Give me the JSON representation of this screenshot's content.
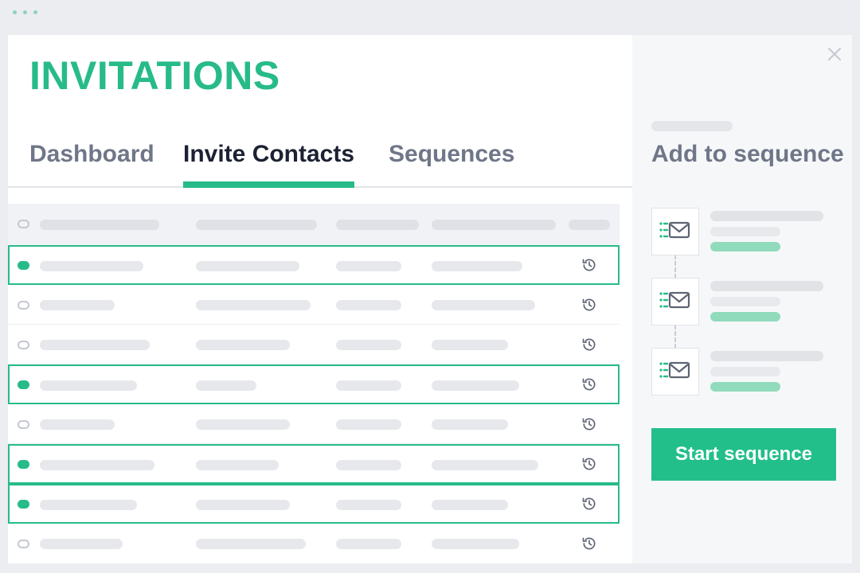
{
  "window_dots": 3,
  "app": {
    "title": "INVITATIONS"
  },
  "tabs": [
    {
      "id": "dashboard",
      "label": "Dashboard",
      "active": false
    },
    {
      "id": "invite",
      "label": "Invite Contacts",
      "active": true
    },
    {
      "id": "sequences",
      "label": "Sequences",
      "active": false
    }
  ],
  "table": {
    "header": {
      "columns": 5,
      "content": "placeholder-skeleton"
    },
    "rows": [
      {
        "selected": true,
        "action_icon": "history-icon"
      },
      {
        "selected": false,
        "action_icon": "history-icon"
      },
      {
        "selected": false,
        "action_icon": "history-icon"
      },
      {
        "selected": true,
        "action_icon": "history-icon"
      },
      {
        "selected": false,
        "action_icon": "history-icon"
      },
      {
        "selected": true,
        "action_icon": "history-icon"
      },
      {
        "selected": true,
        "action_icon": "history-icon"
      },
      {
        "selected": false,
        "action_icon": "history-icon"
      }
    ]
  },
  "panel": {
    "title": "Add to sequence",
    "steps": [
      {
        "icon": "email-list-icon"
      },
      {
        "icon": "email-list-icon"
      },
      {
        "icon": "email-list-icon"
      }
    ],
    "start_button": "Start sequence",
    "close_icon": "close-icon"
  },
  "colors": {
    "accent": "#27bb88",
    "button": "#22bf8a",
    "tab_active": "#1c2233",
    "tab_inactive": "#6f7688",
    "background": "#ebedf1"
  }
}
